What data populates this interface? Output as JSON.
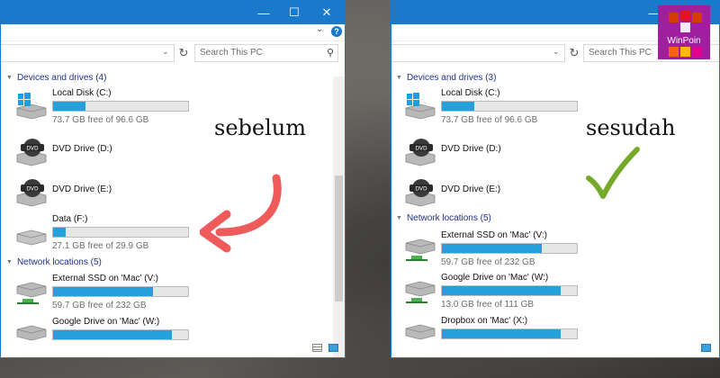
{
  "windows": {
    "left": {
      "controls": {
        "minimize": "—",
        "maximize": "☐",
        "close": "✕"
      },
      "search_placeholder": "Search This PC",
      "sections": {
        "devices": "Devices and drives (4)",
        "network": "Network locations (5)"
      },
      "drives": [
        {
          "name": "Local Disk (C:)",
          "free": "73.7 GB free of 96.6 GB",
          "fill": 0.24,
          "icon": "windows-drive-icon"
        },
        {
          "name": "DVD Drive (D:)",
          "icon": "dvd-drive-icon"
        },
        {
          "name": "DVD Drive (E:)",
          "icon": "dvd-drive-icon"
        },
        {
          "name": "Data (F:)",
          "free": "27.1 GB free of 29.9 GB",
          "fill": 0.09,
          "icon": "hard-drive-icon"
        }
      ],
      "network": [
        {
          "name": "External SSD on 'Mac' (V:)",
          "free": "59.7 GB free of 232 GB",
          "fill": 0.74,
          "icon": "network-drive-icon"
        },
        {
          "name": "Google Drive on 'Mac' (W:)",
          "free": "",
          "fill": 0.88,
          "icon": "network-drive-icon"
        }
      ]
    },
    "right": {
      "controls": {
        "minimize": "—",
        "maximize": "☐",
        "close": "✕"
      },
      "search_placeholder": "Search This PC",
      "sections": {
        "devices": "Devices and drives (3)",
        "network": "Network locations (5)"
      },
      "drives": [
        {
          "name": "Local Disk (C:)",
          "free": "73.7 GB free of 96.6 GB",
          "fill": 0.24,
          "icon": "windows-drive-icon"
        },
        {
          "name": "DVD Drive (D:)",
          "icon": "dvd-drive-icon"
        },
        {
          "name": "DVD Drive (E:)",
          "icon": "dvd-drive-icon"
        }
      ],
      "network": [
        {
          "name": "External SSD on 'Mac' (V:)",
          "free": "59.7 GB free of 232 GB",
          "fill": 0.74,
          "icon": "network-drive-icon"
        },
        {
          "name": "Google Drive on 'Mac' (W:)",
          "free": "13.0 GB free of 111 GB",
          "fill": 0.88,
          "icon": "network-drive-icon"
        },
        {
          "name": "Dropbox on 'Mac' (X:)",
          "free": "",
          "fill": 0.88,
          "icon": "network-drive-icon"
        }
      ]
    }
  },
  "annotations": {
    "before": "sebelum",
    "after": "sesudah",
    "arrow_color": "#ef5b5b",
    "check_color": "#74a92a"
  },
  "logo": {
    "text": "WinPoin",
    "bg": "#a01f9e"
  },
  "colors": {
    "accent": "#1979ca",
    "bar_fill": "#26a0da"
  }
}
